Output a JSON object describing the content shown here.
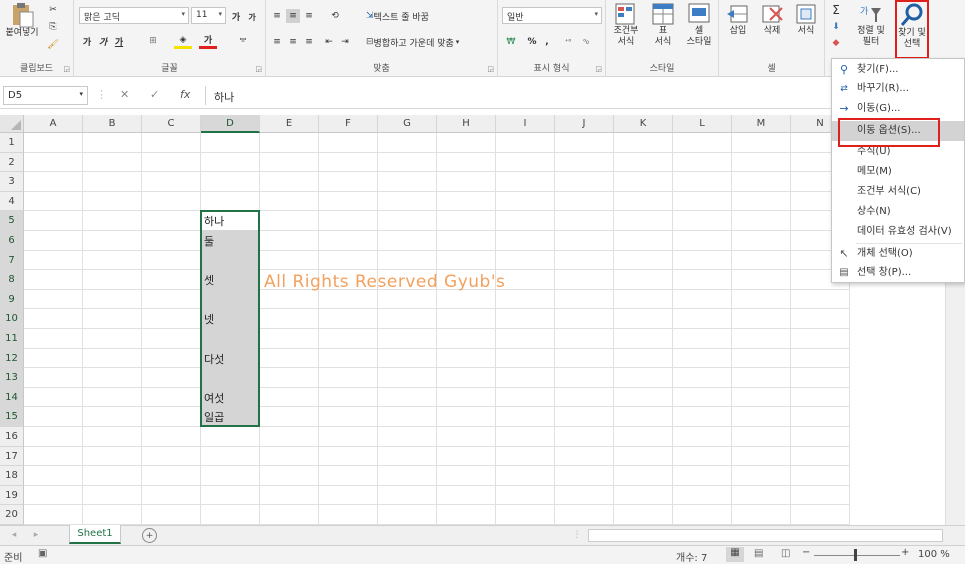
{
  "ribbon": {
    "clipboard": {
      "paste_label": "붙여넣기",
      "group_label": "클립보드"
    },
    "font": {
      "font_name": "맑은 고딕",
      "font_size": "11",
      "grow": "가",
      "shrink": "가",
      "bold": "가",
      "italic": "가",
      "underline": "가",
      "group_label": "글꼴"
    },
    "alignment": {
      "wrap_label": "텍스트 줄 바꿈",
      "merge_label": "병합하고 가운데 맞춤",
      "group_label": "맞춤"
    },
    "number": {
      "format": "일반",
      "percent": "%",
      "comma": ",",
      "group_label": "표시 형식"
    },
    "styles": {
      "conditional": "조건부\n서식",
      "table": "표\n서식",
      "cell_style": "셀\n스타일",
      "group_label": "스타일"
    },
    "cells": {
      "insert": "삽입",
      "delete": "삭제",
      "format": "서식",
      "group_label": "셀"
    },
    "editing": {
      "sort_filter": "정렬 및\n필터",
      "find_select": "찾기 및\n선택",
      "sigma": "Σ"
    }
  },
  "formula_bar": {
    "name_box": "D5",
    "fx": "fx",
    "content": "하나"
  },
  "columns": [
    "A",
    "B",
    "C",
    "D",
    "E",
    "F",
    "G",
    "H",
    "I",
    "J",
    "K",
    "L",
    "M",
    "N"
  ],
  "rows": [
    "1",
    "2",
    "3",
    "4",
    "5",
    "6",
    "7",
    "8",
    "9",
    "10",
    "11",
    "12",
    "13",
    "14",
    "15",
    "16",
    "17",
    "18",
    "19",
    "20"
  ],
  "cells": {
    "D5": "하나",
    "D6": "둘",
    "D8": "셋",
    "D10": "넷",
    "D12": "다섯",
    "D14": "여섯",
    "D15": "일곱"
  },
  "watermark": "All Rights Reserved Gyub's",
  "sheet_tab": "Sheet1",
  "status": {
    "ready": "준비",
    "count": "개수: 7",
    "zoom": "100 %"
  },
  "menu": {
    "find": "찾기(F)...",
    "replace": "바꾸기(R)...",
    "goto": "이동(G)...",
    "goto_special": "이동 옵션(S)...",
    "formulas": "수식(U)",
    "comments": "메모(M)",
    "cond_format": "조건부 서식(C)",
    "constants": "상수(N)",
    "data_validation": "데이터 유효성 검사(V)",
    "select_objects": "개체 선택(O)",
    "selection_pane": "선택 창(P)..."
  }
}
